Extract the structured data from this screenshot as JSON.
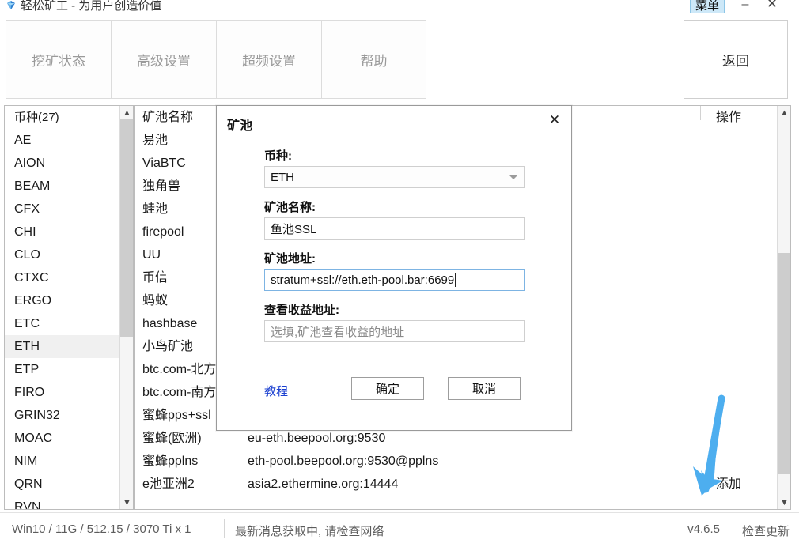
{
  "window": {
    "title": "轻松矿工 - 为用户创造价值",
    "app_icon": "gem-icon",
    "menu_label": "菜单",
    "minimize_label": "–",
    "close_label": "✕",
    "accent_color": "#4daeef"
  },
  "tabs": [
    {
      "label": "挖矿状态",
      "name": "tab-mining-status"
    },
    {
      "label": "高级设置",
      "name": "tab-advanced-settings"
    },
    {
      "label": "超频设置",
      "name": "tab-overclock-settings"
    },
    {
      "label": "帮助",
      "name": "tab-help"
    }
  ],
  "back_button": {
    "label": "返回"
  },
  "coin_list": {
    "header": "币种(27)",
    "selected": "ETH",
    "items": [
      "AE",
      "AION",
      "BEAM",
      "CFX",
      "CHI",
      "CLO",
      "CTXC",
      "ERGO",
      "ETC",
      "ETH",
      "ETP",
      "FIRO",
      "GRIN32",
      "MOAC",
      "NIM",
      "QRN",
      "RVN"
    ]
  },
  "pool_table": {
    "headers": {
      "name": "矿池名称",
      "address": "",
      "operation": "操作"
    },
    "rows": [
      {
        "name": "易池",
        "address": ""
      },
      {
        "name": "ViaBTC",
        "address": ""
      },
      {
        "name": "独角兽",
        "address": ""
      },
      {
        "name": "蛙池",
        "address": ""
      },
      {
        "name": "firepool",
        "address": ""
      },
      {
        "name": "UU",
        "address": ""
      },
      {
        "name": "币信",
        "address": ""
      },
      {
        "name": "蚂蚁",
        "address": ""
      },
      {
        "name": "hashbase",
        "address": ""
      },
      {
        "name": "小鸟矿池",
        "address": ""
      },
      {
        "name": "btc.com-北方",
        "address": ""
      },
      {
        "name": "btc.com-南方",
        "address": ""
      },
      {
        "name": "蜜蜂pps+ssl",
        "address": ""
      },
      {
        "name": "蜜蜂(欧洲)",
        "address": "eu-eth.beepool.org:9530"
      },
      {
        "name": "蜜蜂pplns",
        "address": "eth-pool.beepool.org:9530@pplns"
      },
      {
        "name": "e池亚洲2",
        "address": "asia2.ethermine.org:14444"
      }
    ],
    "operation_label": "添加"
  },
  "dialog": {
    "title": "矿池",
    "close_label": "✕",
    "fields": {
      "coin_label": "币种:",
      "coin_value": "ETH",
      "pool_name_label": "矿池名称:",
      "pool_name_value": "鱼池SSL",
      "pool_address_label": "矿池地址:",
      "pool_address_value": "stratum+ssl://eth.eth-pool.bar:6699",
      "revenue_address_label": "查看收益地址:",
      "revenue_address_placeholder": "选填,矿池查看收益的地址"
    },
    "tutorial_link": "教程",
    "ok_label": "确定",
    "cancel_label": "取消"
  },
  "status_bar": {
    "system_info": "Win10  /  11G  /  512.15  /  3070 Ti x 1",
    "message": "最新消息获取中, 请检查网络",
    "version": "v4.6.5",
    "update_label": "检查更新"
  }
}
